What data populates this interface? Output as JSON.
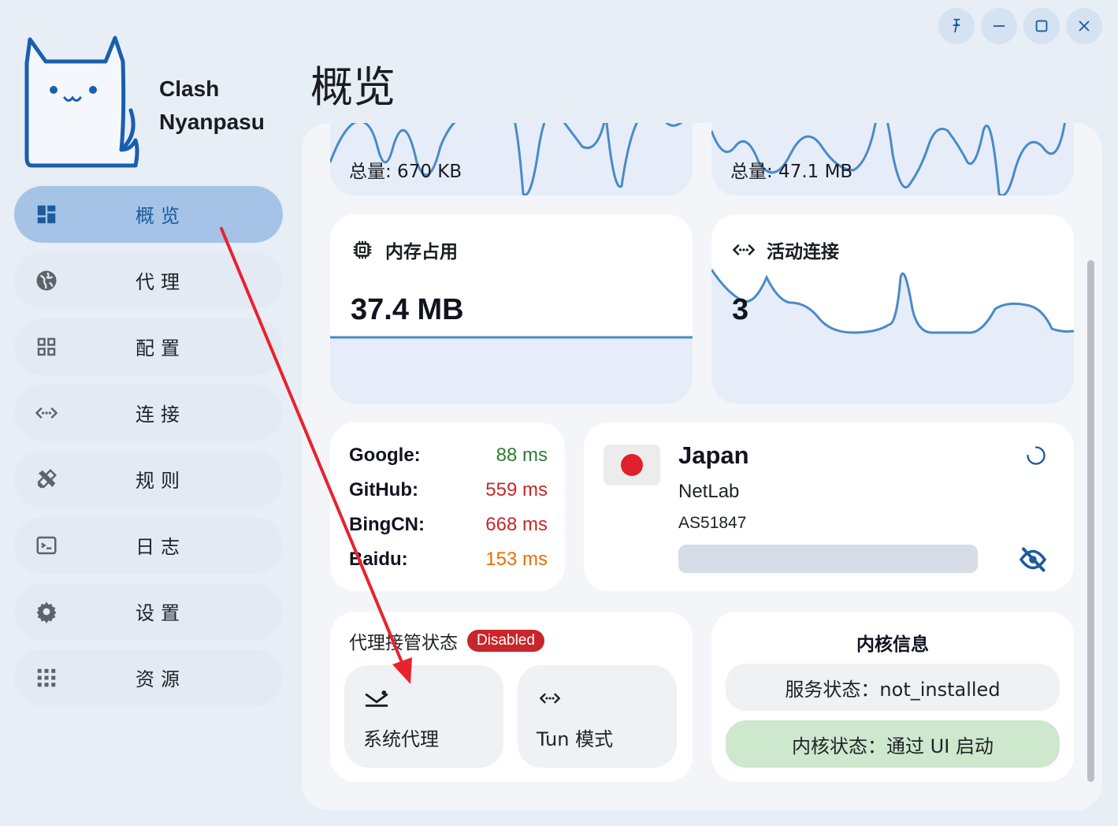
{
  "app": {
    "name_line1": "Clash",
    "name_line2": "Nyanpasu"
  },
  "window_controls": [
    {
      "name": "pin-icon"
    },
    {
      "name": "minimize-icon"
    },
    {
      "name": "maximize-icon"
    },
    {
      "name": "close-icon"
    }
  ],
  "sidebar": {
    "items": [
      {
        "label": "概览",
        "icon": "dashboard-icon",
        "active": true
      },
      {
        "label": "代理",
        "icon": "globe-icon"
      },
      {
        "label": "配置",
        "icon": "grid-icon"
      },
      {
        "label": "连接",
        "icon": "connection-icon"
      },
      {
        "label": "规则",
        "icon": "rules-icon"
      },
      {
        "label": "日志",
        "icon": "terminal-icon"
      },
      {
        "label": "设置",
        "icon": "gear-icon"
      },
      {
        "label": "资源",
        "icon": "apps-icon"
      }
    ]
  },
  "page": {
    "title": "概览"
  },
  "traffic": {
    "upload_total": "总量: 670 KB",
    "download_total": "总量: 47.1 MB"
  },
  "memory": {
    "title": "内存占用",
    "value": "37.4 MB"
  },
  "connections": {
    "title": "活动连接",
    "value": "3"
  },
  "latency": [
    {
      "name": "Google:",
      "value": "88 ms",
      "color": "#2e7d32"
    },
    {
      "name": "GitHub:",
      "value": "559 ms",
      "color": "#c62828"
    },
    {
      "name": "BingCN:",
      "value": "668 ms",
      "color": "#c62828"
    },
    {
      "name": "Baidu:",
      "value": "153 ms",
      "color": "#ef6c00"
    }
  ],
  "ip_info": {
    "country": "Japan",
    "isp": "NetLab",
    "asn": "AS51847",
    "flag_color": "#e0202c"
  },
  "proxy_status": {
    "title": "代理接管状态",
    "badge": "Disabled",
    "system_proxy": "系统代理",
    "tun_mode": "Tun 模式"
  },
  "core_info": {
    "title": "内核信息",
    "service_status": "服务状态：not_installed",
    "core_status": "内核状态：通过 UI 启动"
  },
  "colors": {
    "accent": "#1c5a9c",
    "chart_line": "#4a8ac8",
    "chart_fill": "#e6edf8",
    "active_nav": "#a4c3e6",
    "success_bg": "#cde8cd",
    "annotation_arrow": "#e8232c"
  }
}
